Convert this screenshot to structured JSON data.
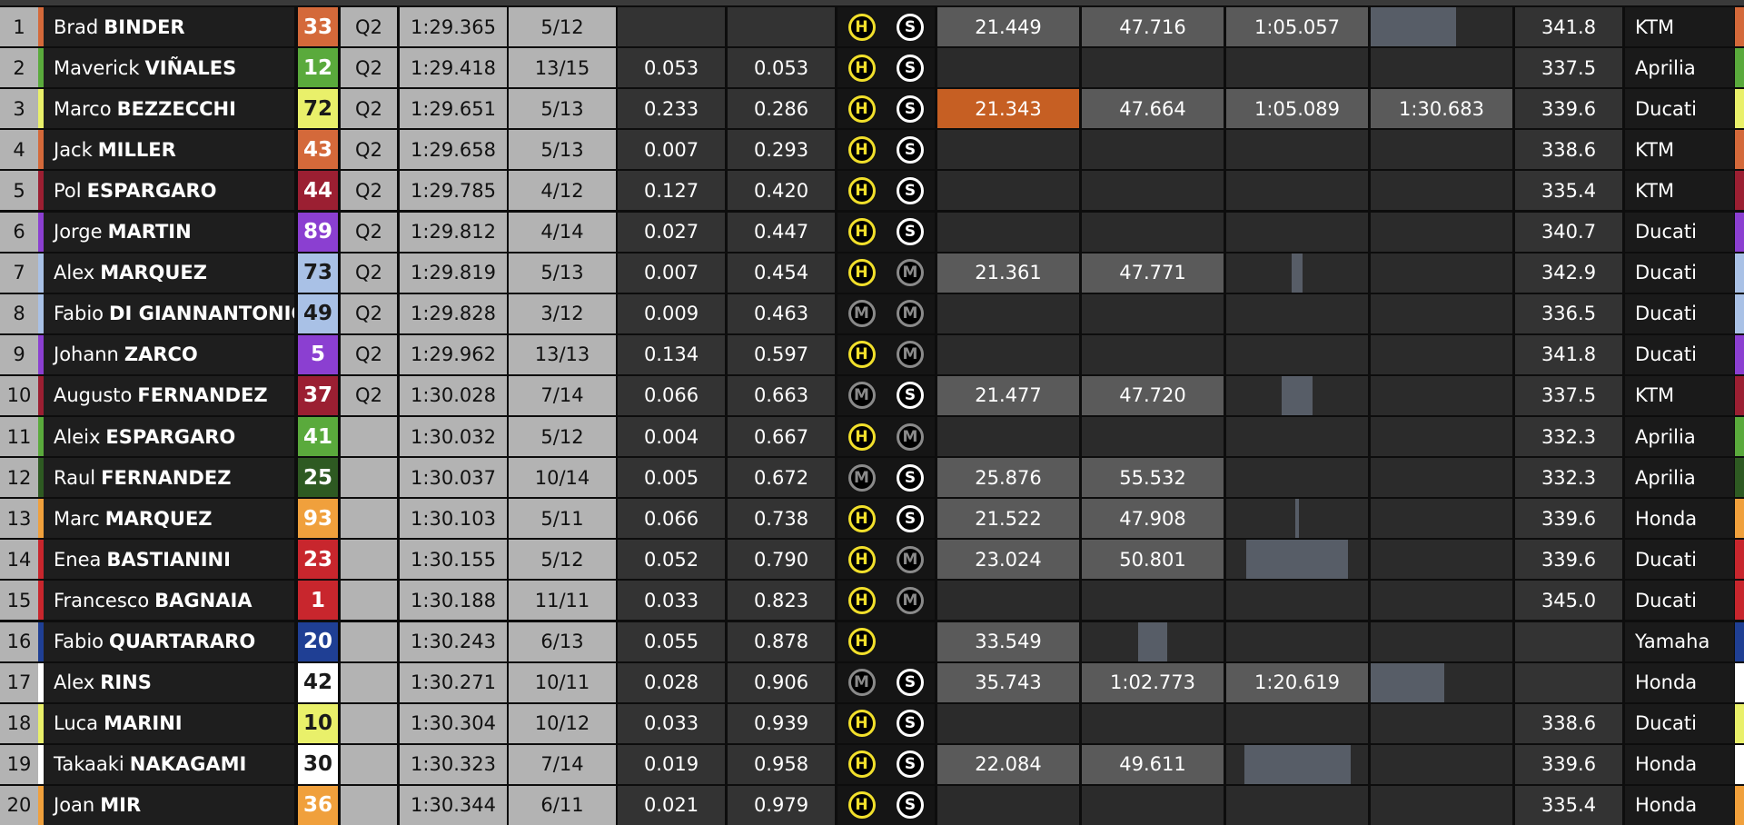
{
  "timing_board": {
    "rows": [
      {
        "pos": "1",
        "first": "Brad",
        "last": "BINDER",
        "num": "33",
        "num_bg": "#d4693a",
        "num_fg": "#ffffff",
        "team_color": "#d4693a",
        "q": "Q2",
        "best": "1:29.365",
        "laps": "5/12",
        "gap": "",
        "gap_first": "",
        "tyre_front": "H",
        "tyre_rear": "S",
        "s1": "21.449",
        "s1_style": "grey",
        "s2": "47.716",
        "s2_style": "grey",
        "s3": "1:05.057",
        "s3_style": "grey",
        "s4": "",
        "s4_style": "",
        "s4_progress": 0.6,
        "speed": "341.8",
        "make": "KTM",
        "edge_color": "#d4693a"
      },
      {
        "pos": "2",
        "first": "Maverick",
        "last": "VIÑALES",
        "num": "12",
        "num_bg": "#5aaa3c",
        "num_fg": "#ffffff",
        "team_color": "#5aaa3c",
        "q": "Q2",
        "best": "1:29.418",
        "laps": "13/15",
        "gap": "0.053",
        "gap_first": "0.053",
        "tyre_front": "H",
        "tyre_rear": "S",
        "s1": "",
        "s1_style": "",
        "s2": "",
        "s2_style": "",
        "s3": "",
        "s3_style": "",
        "s4": "",
        "s4_style": "",
        "s4_progress": 0,
        "speed": "337.5",
        "make": "Aprilia",
        "edge_color": "#5aaa3c"
      },
      {
        "pos": "3",
        "first": "Marco",
        "last": "BEZZECCHI",
        "num": "72",
        "num_bg": "#e9f06a",
        "num_fg": "#1a1a1a",
        "team_color": "#e9f06a",
        "q": "Q2",
        "best": "1:29.651",
        "laps": "5/13",
        "gap": "0.233",
        "gap_first": "0.286",
        "tyre_front": "H",
        "tyre_rear": "S",
        "s1": "21.343",
        "s1_style": "orange",
        "s2": "47.664",
        "s2_style": "grey",
        "s3": "1:05.089",
        "s3_style": "grey",
        "s4": "1:30.683",
        "s4_style": "grey",
        "s4_progress": 0,
        "speed": "339.6",
        "make": "Ducati",
        "edge_color": "#e9f06a"
      },
      {
        "pos": "4",
        "first": "Jack",
        "last": "MILLER",
        "num": "43",
        "num_bg": "#d4693a",
        "num_fg": "#ffffff",
        "team_color": "#d4693a",
        "q": "Q2",
        "best": "1:29.658",
        "laps": "5/13",
        "gap": "0.007",
        "gap_first": "0.293",
        "tyre_front": "H",
        "tyre_rear": "S",
        "s1": "",
        "s1_style": "",
        "s2": "",
        "s2_style": "",
        "s3": "",
        "s3_style": "",
        "s4": "",
        "s4_style": "",
        "s4_progress": 0,
        "speed": "338.6",
        "make": "KTM",
        "edge_color": "#d4693a"
      },
      {
        "pos": "5",
        "first": "Pol",
        "last": "ESPARGARO",
        "num": "44",
        "num_bg": "#9b1f32",
        "num_fg": "#ffffff",
        "team_color": "#9b1f32",
        "q": "Q2",
        "best": "1:29.785",
        "laps": "4/12",
        "gap": "0.127",
        "gap_first": "0.420",
        "tyre_front": "H",
        "tyre_rear": "S",
        "s1": "",
        "s1_style": "",
        "s2": "",
        "s2_style": "",
        "s3": "",
        "s3_style": "",
        "s4": "",
        "s4_style": "",
        "s4_progress": 0,
        "speed": "335.4",
        "make": "KTM",
        "edge_color": "#9b1f32"
      },
      {
        "pos": "6",
        "first": "Jorge",
        "last": "MARTIN",
        "num": "89",
        "num_bg": "#8b3fd1",
        "num_fg": "#ffffff",
        "team_color": "#8b3fd1",
        "q": "Q2",
        "best": "1:29.812",
        "laps": "4/14",
        "gap": "0.027",
        "gap_first": "0.447",
        "tyre_front": "H",
        "tyre_rear": "S",
        "s1": "",
        "s1_style": "",
        "s2": "",
        "s2_style": "",
        "s3": "",
        "s3_style": "",
        "s4": "",
        "s4_style": "",
        "s4_progress": 0,
        "speed": "340.7",
        "make": "Ducati",
        "edge_color": "#8b3fd1"
      },
      {
        "pos": "7",
        "first": "Alex",
        "last": "MARQUEZ",
        "num": "73",
        "num_bg": "#a9c1e6",
        "num_fg": "#1a1a1a",
        "team_color": "#a9c1e6",
        "q": "Q2",
        "best": "1:29.819",
        "laps": "5/13",
        "gap": "0.007",
        "gap_first": "0.454",
        "tyre_front": "H",
        "tyre_rear": "M",
        "s1": "21.361",
        "s1_style": "grey",
        "s2": "47.771",
        "s2_style": "grey",
        "s3": "",
        "s3_style": "",
        "s4": "",
        "s4_style": "",
        "s4_progress": 0,
        "s3_progress": 0.08,
        "speed": "342.9",
        "make": "Ducati",
        "edge_color": "#a9c1e6"
      },
      {
        "pos": "8",
        "first": "Fabio",
        "last": "DI GIANNANTONIO",
        "num": "49",
        "num_bg": "#a9c1e6",
        "num_fg": "#1a1a1a",
        "team_color": "#a9c1e6",
        "q": "Q2",
        "best": "1:29.828",
        "laps": "3/12",
        "gap": "0.009",
        "gap_first": "0.463",
        "tyre_front": "M",
        "tyre_rear": "M",
        "s1": "",
        "s1_style": "",
        "s2": "",
        "s2_style": "",
        "s3": "",
        "s3_style": "",
        "s4": "",
        "s4_style": "",
        "s4_progress": 0,
        "speed": "336.5",
        "make": "Ducati",
        "edge_color": "#a9c1e6"
      },
      {
        "pos": "9",
        "first": "Johann",
        "last": "ZARCO",
        "num": "5",
        "num_bg": "#8b3fd1",
        "num_fg": "#ffffff",
        "team_color": "#8b3fd1",
        "q": "Q2",
        "best": "1:29.962",
        "laps": "13/13",
        "gap": "0.134",
        "gap_first": "0.597",
        "tyre_front": "H",
        "tyre_rear": "M",
        "s1": "",
        "s1_style": "",
        "s2": "",
        "s2_style": "",
        "s3": "",
        "s3_style": "",
        "s4": "",
        "s4_style": "",
        "s4_progress": 0,
        "speed": "341.8",
        "make": "Ducati",
        "edge_color": "#8b3fd1"
      },
      {
        "pos": "10",
        "first": "Augusto",
        "last": "FERNANDEZ",
        "num": "37",
        "num_bg": "#9b1f32",
        "num_fg": "#ffffff",
        "team_color": "#9b1f32",
        "q": "Q2",
        "best": "1:30.028",
        "laps": "7/14",
        "gap": "0.066",
        "gap_first": "0.663",
        "tyre_front": "M",
        "tyre_rear": "S",
        "s1": "21.477",
        "s1_style": "grey",
        "s2": "47.720",
        "s2_style": "grey",
        "s3": "",
        "s3_style": "",
        "s4": "",
        "s4_style": "",
        "s4_progress": 0,
        "s3_progress": 0.22,
        "speed": "337.5",
        "make": "KTM",
        "edge_color": "#9b1f32"
      },
      {
        "pos": "11",
        "first": "Aleix",
        "last": "ESPARGARO",
        "num": "41",
        "num_bg": "#5aaa3c",
        "num_fg": "#ffffff",
        "team_color": "#5aaa3c",
        "q": "",
        "best": "1:30.032",
        "laps": "5/12",
        "gap": "0.004",
        "gap_first": "0.667",
        "tyre_front": "H",
        "tyre_rear": "M",
        "s1": "",
        "s1_style": "",
        "s2": "",
        "s2_style": "",
        "s3": "",
        "s3_style": "",
        "s4": "",
        "s4_style": "",
        "s4_progress": 0,
        "speed": "332.3",
        "make": "Aprilia",
        "edge_color": "#5aaa3c"
      },
      {
        "pos": "12",
        "first": "Raul",
        "last": "FERNANDEZ",
        "num": "25",
        "num_bg": "#2e5a22",
        "num_fg": "#ffffff",
        "team_color": "#2e5a22",
        "q": "",
        "best": "1:30.037",
        "laps": "10/14",
        "gap": "0.005",
        "gap_first": "0.672",
        "tyre_front": "M",
        "tyre_rear": "S",
        "s1": "25.876",
        "s1_style": "grey",
        "s2": "55.532",
        "s2_style": "grey",
        "s3": "",
        "s3_style": "",
        "s4": "",
        "s4_style": "",
        "s4_progress": 0,
        "speed": "332.3",
        "make": "Aprilia",
        "edge_color": "#2e5a22"
      },
      {
        "pos": "13",
        "first": "Marc",
        "last": "MARQUEZ",
        "num": "93",
        "num_bg": "#f0a03c",
        "num_fg": "#ffffff",
        "team_color": "#f0a03c",
        "q": "",
        "best": "1:30.103",
        "laps": "5/11",
        "gap": "0.066",
        "gap_first": "0.738",
        "tyre_front": "H",
        "tyre_rear": "S",
        "s1": "21.522",
        "s1_style": "grey",
        "s2": "47.908",
        "s2_style": "grey",
        "s3": "",
        "s3_style": "",
        "s4": "",
        "s4_style": "",
        "s4_progress": 0,
        "s3_progress": 0.03,
        "speed": "339.6",
        "make": "Honda",
        "edge_color": "#f0a03c"
      },
      {
        "pos": "14",
        "first": "Enea",
        "last": "BASTIANINI",
        "num": "23",
        "num_bg": "#c8262d",
        "num_fg": "#ffffff",
        "team_color": "#c8262d",
        "q": "",
        "best": "1:30.155",
        "laps": "5/12",
        "gap": "0.052",
        "gap_first": "0.790",
        "tyre_front": "H",
        "tyre_rear": "M",
        "s1": "23.024",
        "s1_style": "grey",
        "s2": "50.801",
        "s2_style": "grey",
        "s3": "",
        "s3_style": "",
        "s4": "",
        "s4_style": "",
        "s4_progress": 0,
        "s3_progress": 0.72,
        "speed": "339.6",
        "make": "Ducati",
        "edge_color": "#c8262d"
      },
      {
        "pos": "15",
        "first": "Francesco",
        "last": "BAGNAIA",
        "num": "1",
        "num_bg": "#c8262d",
        "num_fg": "#ffffff",
        "team_color": "#c8262d",
        "q": "",
        "best": "1:30.188",
        "laps": "11/11",
        "gap": "0.033",
        "gap_first": "0.823",
        "tyre_front": "H",
        "tyre_rear": "M",
        "s1": "",
        "s1_style": "",
        "s2": "",
        "s2_style": "",
        "s3": "",
        "s3_style": "",
        "s4": "",
        "s4_style": "",
        "s4_progress": 0,
        "speed": "345.0",
        "make": "Ducati",
        "edge_color": "#c8262d"
      },
      {
        "pos": "16",
        "first": "Fabio",
        "last": "QUARTARARO",
        "num": "20",
        "num_bg": "#1f3f94",
        "num_fg": "#ffffff",
        "team_color": "#1f3f94",
        "q": "",
        "best": "1:30.243",
        "laps": "6/13",
        "gap": "0.055",
        "gap_first": "0.878",
        "tyre_front": "H",
        "tyre_rear": "",
        "s1": "33.549",
        "s1_style": "grey",
        "s2": "",
        "s2_style": "",
        "s3": "",
        "s3_style": "",
        "s4": "",
        "s4_style": "",
        "s4_progress": 0,
        "s2_progress": 0.2,
        "speed": "",
        "make": "Yamaha",
        "edge_color": "#1f3f94"
      },
      {
        "pos": "17",
        "first": "Alex",
        "last": "RINS",
        "num": "42",
        "num_bg": "#ffffff",
        "num_fg": "#1a1a1a",
        "team_color": "#ffffff",
        "q": "",
        "best": "1:30.271",
        "laps": "10/11",
        "gap": "0.028",
        "gap_first": "0.906",
        "tyre_front": "M",
        "tyre_rear": "S",
        "s1": "35.743",
        "s1_style": "grey",
        "s2": "1:02.773",
        "s2_style": "grey",
        "s3": "1:20.619",
        "s3_style": "grey",
        "s4": "",
        "s4_style": "",
        "s4_progress": 0.52,
        "speed": "",
        "make": "Honda",
        "edge_color": "#ffffff"
      },
      {
        "pos": "18",
        "first": "Luca",
        "last": "MARINI",
        "num": "10",
        "num_bg": "#e9f06a",
        "num_fg": "#1a1a1a",
        "team_color": "#e9f06a",
        "q": "",
        "best": "1:30.304",
        "laps": "10/12",
        "gap": "0.033",
        "gap_first": "0.939",
        "tyre_front": "H",
        "tyre_rear": "S",
        "s1": "",
        "s1_style": "",
        "s2": "",
        "s2_style": "",
        "s3": "",
        "s3_style": "",
        "s4": "",
        "s4_style": "",
        "s4_progress": 0,
        "speed": "338.6",
        "make": "Ducati",
        "edge_color": "#e9f06a"
      },
      {
        "pos": "19",
        "first": "Takaaki",
        "last": "NAKAGAMI",
        "num": "30",
        "num_bg": "#ffffff",
        "num_fg": "#1a1a1a",
        "team_color": "#ffffff",
        "q": "",
        "best": "1:30.323",
        "laps": "7/14",
        "gap": "0.019",
        "gap_first": "0.958",
        "tyre_front": "H",
        "tyre_rear": "S",
        "s1": "22.084",
        "s1_style": "grey",
        "s2": "49.611",
        "s2_style": "grey",
        "s3": "",
        "s3_style": "",
        "s4": "",
        "s4_style": "",
        "s4_progress": 0,
        "s3_progress": 0.75,
        "speed": "339.6",
        "make": "Honda",
        "edge_color": "#ffffff"
      },
      {
        "pos": "20",
        "first": "Joan",
        "last": "MIR",
        "num": "36",
        "num_bg": "#f0a03c",
        "num_fg": "#ffffff",
        "team_color": "#f0a03c",
        "q": "",
        "best": "1:30.344",
        "laps": "6/11",
        "gap": "0.021",
        "gap_first": "0.979",
        "tyre_front": "H",
        "tyre_rear": "S",
        "s1": "",
        "s1_style": "",
        "s2": "",
        "s2_style": "",
        "s3": "",
        "s3_style": "",
        "s4": "",
        "s4_style": "",
        "s4_progress": 0,
        "speed": "335.4",
        "make": "Honda",
        "edge_color": "#f0a03c"
      }
    ]
  }
}
